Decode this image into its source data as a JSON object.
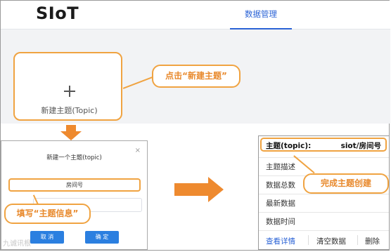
{
  "header": {
    "logo": "SIoT",
    "tab": "数据管理"
  },
  "new_topic_card": {
    "label": "新建主题(Topic)"
  },
  "callouts": {
    "click_new": "点击“新建主题”",
    "fill_info": "填写“主题信息”",
    "done": "完成主题创建"
  },
  "dialog": {
    "title": "新建一个主题(topic)",
    "close": "×",
    "name_value": "房间号",
    "cancel": "取 消",
    "confirm": "确 定"
  },
  "detail": {
    "topic_key": "主题(topic):",
    "topic_value": "siot/房间号",
    "rows": [
      "主题描述",
      "数据总数",
      "最新数据",
      "数据时间"
    ],
    "actions": {
      "view": "查看详情",
      "clear": "清空数据",
      "delete": "删除"
    }
  },
  "watermark": "九诚讯根",
  "colors": {
    "accent": "#2b63d6",
    "highlight": "#f0a341",
    "callout_text": "#e8892c",
    "arrow": "#ee8a2f"
  }
}
